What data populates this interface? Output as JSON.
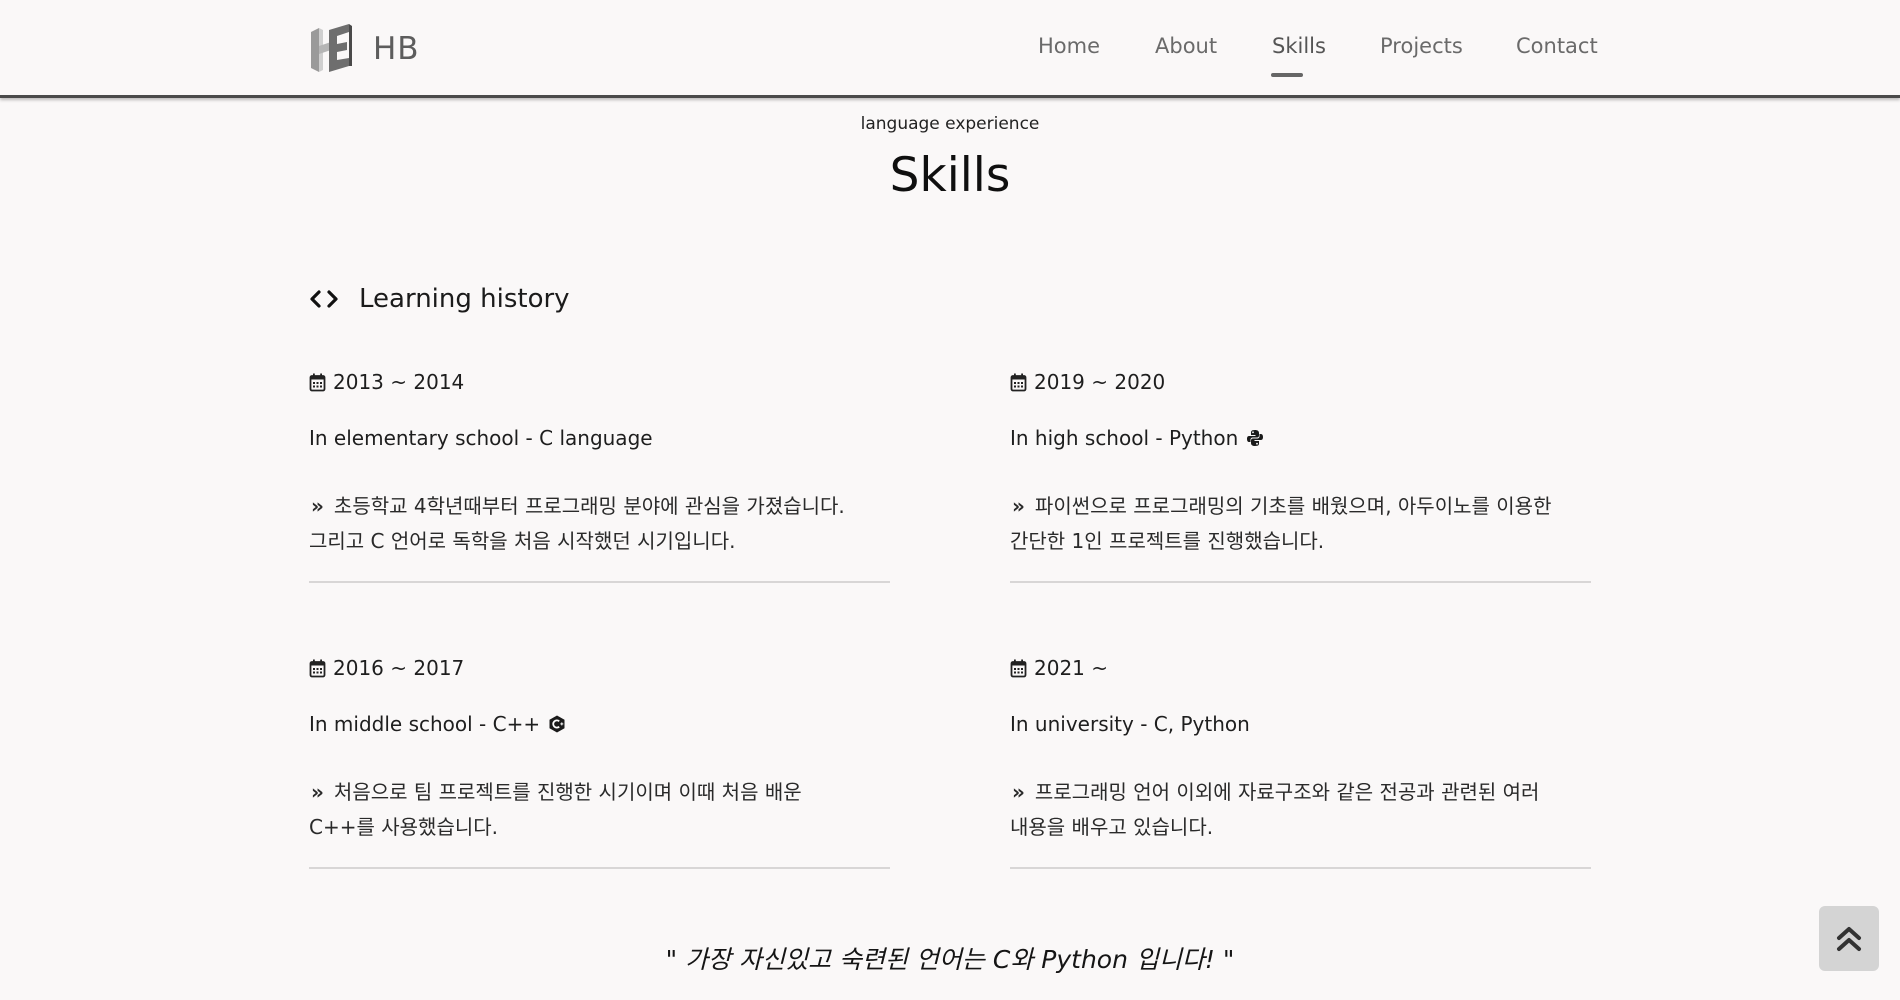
{
  "header": {
    "logo_text": "HB",
    "nav": [
      {
        "label": "Home"
      },
      {
        "label": "About"
      },
      {
        "label": "Skills",
        "active": true
      },
      {
        "label": "Projects"
      },
      {
        "label": "Contact"
      }
    ]
  },
  "page": {
    "subtitle": "language experience",
    "title": "Skills"
  },
  "section": {
    "icon": "code-icon",
    "title": "Learning history"
  },
  "cards": [
    {
      "date": "2013 ~ 2014",
      "heading": "In elementary school - C language",
      "heading_icon": "",
      "desc_line1": "초등학교 4학년때부터 프로그래밍 분야에 관심을 가졌습니다.",
      "desc_line2": "그리고 C 언어로 독학을 처음 시작했던 시기입니다."
    },
    {
      "date": "2019 ~ 2020",
      "heading": "In high school - Python",
      "heading_icon": "python-icon",
      "desc_line1": "파이썬으로 프로그래밍의 기초를 배웠으며, 아두이노를 이용한",
      "desc_line2": "간단한 1인 프로젝트를 진행했습니다."
    },
    {
      "date": "2016 ~ 2017",
      "heading": "In middle school - C++",
      "heading_icon": "cplusplus-icon",
      "desc_line1": "처음으로 팀 프로젝트를 진행한 시기이며 이때 처음 배운",
      "desc_line2": "C++를 사용했습니다."
    },
    {
      "date": "2021 ~",
      "heading": "In university - C, Python",
      "heading_icon": "",
      "desc_line1": "프로그래밍 언어 이외에 자료구조와 같은 전공과 관련된 여러",
      "desc_line2": "내용을 배우고 있습니다."
    }
  ],
  "desc_marker": "»",
  "quote": "\" 가장 자신있고 숙련된 언어는 C와 Python 입니다! \"",
  "colors": {
    "background": "#faf8f8",
    "header_border": "#4a4a4a",
    "nav_text": "#6a6a6a",
    "rule": "#d8d6d6",
    "top_button": "#d4d4d4"
  }
}
